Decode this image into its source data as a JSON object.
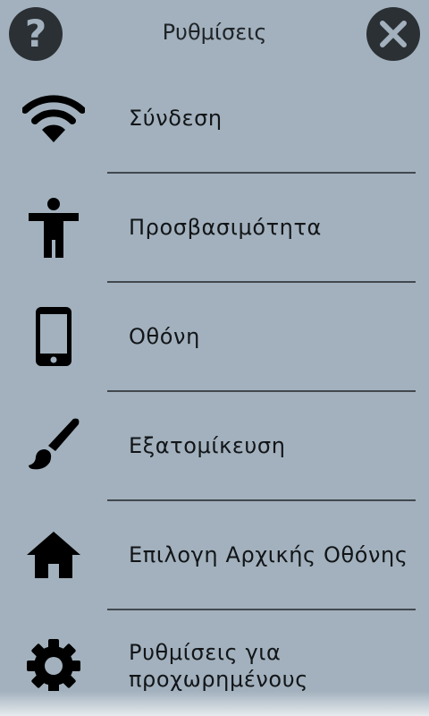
{
  "header": {
    "title": "Ρυθμίσεις",
    "help_icon": "help-icon",
    "close_icon": "close-icon"
  },
  "menu": {
    "items": [
      {
        "label": "Σύνδεση",
        "icon": "wifi-icon"
      },
      {
        "label": "Προσβασιμότητα",
        "icon": "accessibility-icon"
      },
      {
        "label": "Οθόνη",
        "icon": "phone-display-icon"
      },
      {
        "label": "Εξατομίκευση",
        "icon": "paintbrush-icon"
      },
      {
        "label": "Επιλογη Αρχικής Οθόνης",
        "icon": "home-icon"
      },
      {
        "label_line1": "Ρυθμίσεις για",
        "label_line2": "προχωρημένους",
        "icon": "gear-icon"
      }
    ]
  },
  "colors": {
    "background": "#a2b1bd",
    "button": "#2b3034",
    "text": "#121518",
    "divider": "#41484e"
  }
}
